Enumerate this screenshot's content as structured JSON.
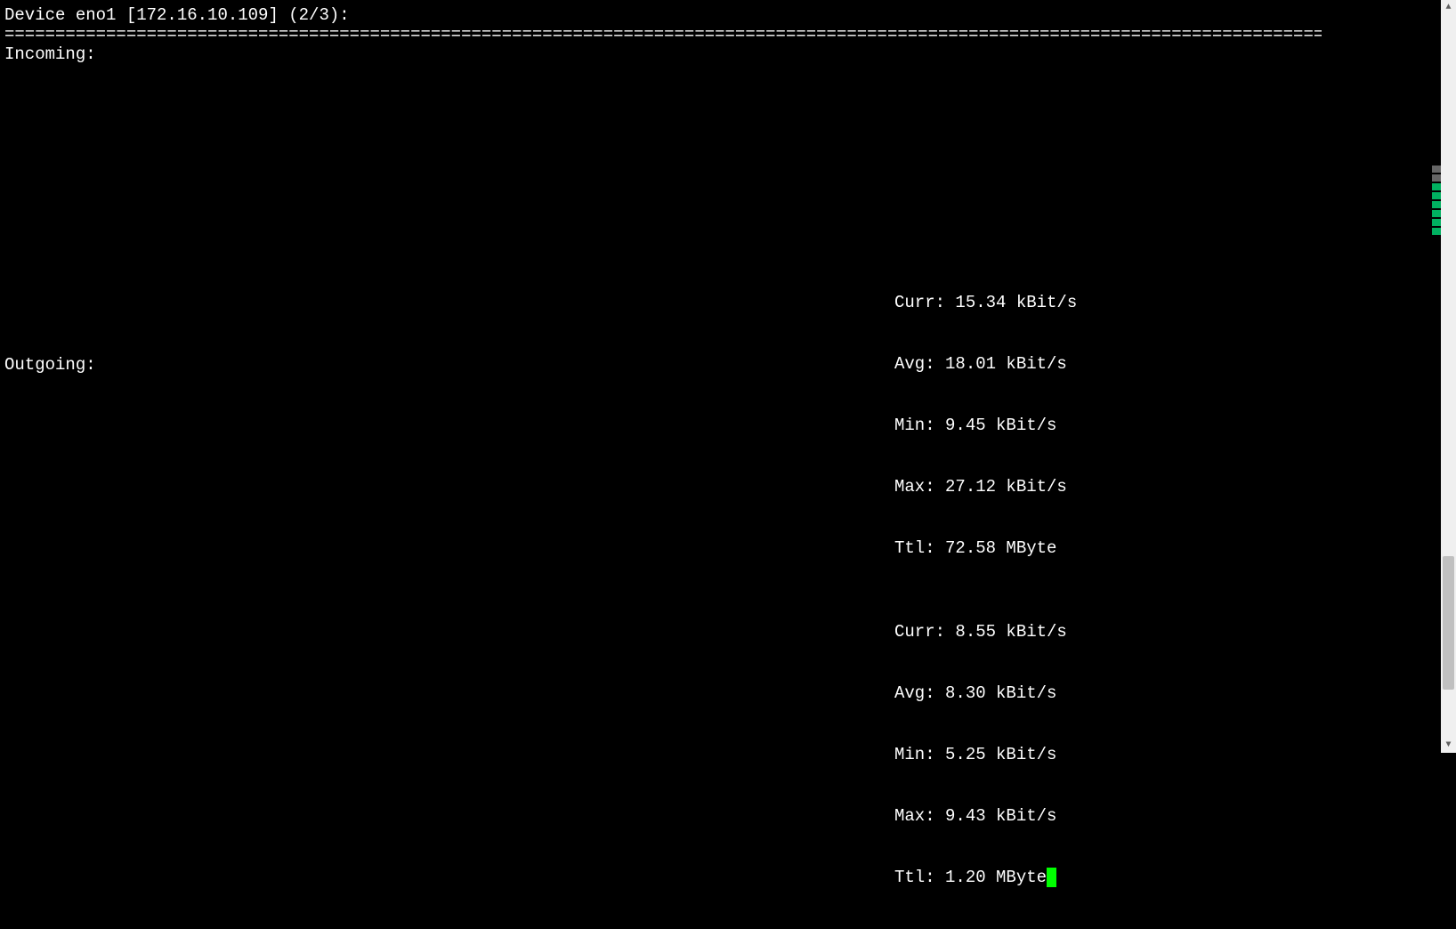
{
  "header": {
    "device_line": "Device eno1 [172.16.10.109] (2/3):",
    "divider": "==============================================================================================================================================================================================================================================================================================================================="
  },
  "incoming": {
    "label": "Incoming:",
    "stats": {
      "curr": "Curr: 15.34 kBit/s",
      "avg": "Avg: 18.01 kBit/s",
      "min": "Min: 9.45 kBit/s",
      "max": "Max: 27.12 kBit/s",
      "ttl": "Ttl: 72.58 MByte"
    }
  },
  "outgoing": {
    "label": "Outgoing:",
    "stats": {
      "curr": "Curr: 8.55 kBit/s",
      "avg": "Avg: 8.30 kBit/s",
      "min": "Min: 5.25 kBit/s",
      "max": "Max: 9.43 kBit/s",
      "ttl": "Ttl: 1.20 MByte"
    }
  }
}
